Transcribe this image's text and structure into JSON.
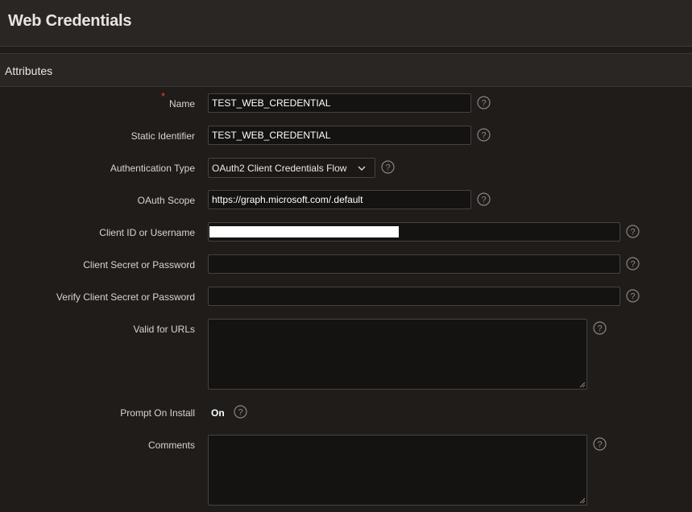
{
  "page": {
    "title": "Web Credentials"
  },
  "region": {
    "title": "Attributes"
  },
  "form": {
    "name": {
      "label": "Name",
      "required_marker": "*",
      "value": "TEST_WEB_CREDENTIAL"
    },
    "static_identifier": {
      "label": "Static Identifier",
      "value": "TEST_WEB_CREDENTIAL"
    },
    "authentication_type": {
      "label": "Authentication Type",
      "value": "OAuth2 Client Credentials Flow"
    },
    "oauth_scope": {
      "label": "OAuth Scope",
      "value": "https://graph.microsoft.com/.default"
    },
    "client_id": {
      "label": "Client ID or Username",
      "value_redacted": true
    },
    "client_secret": {
      "label": "Client Secret or Password",
      "value": ""
    },
    "verify_client_secret": {
      "label": "Verify Client Secret or Password",
      "value": ""
    },
    "valid_for_urls": {
      "label": "Valid for URLs",
      "value": ""
    },
    "prompt_on_install": {
      "label": "Prompt On Install",
      "value": "On"
    },
    "comments": {
      "label": "Comments",
      "value": ""
    }
  },
  "icons": {
    "help": "help-circle-icon",
    "dropdown": "chevron-down-icon"
  },
  "colors": {
    "background": "#1f1c1a",
    "header": "#2a2624",
    "input_bg": "#151311",
    "border": "#48423e",
    "required": "#e5433b",
    "help_icon": "#8c8580"
  }
}
